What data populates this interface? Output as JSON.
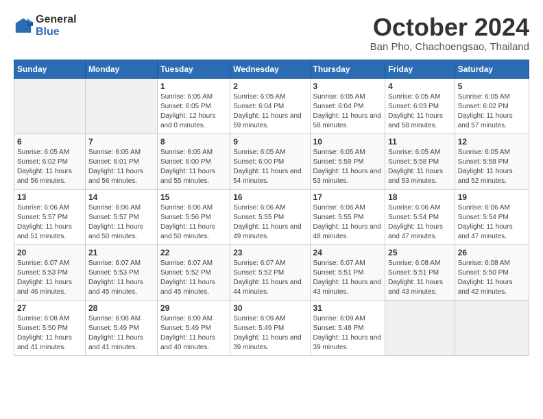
{
  "logo": {
    "general": "General",
    "blue": "Blue"
  },
  "header": {
    "month": "October 2024",
    "location": "Ban Pho, Chachoengsao, Thailand"
  },
  "weekdays": [
    "Sunday",
    "Monday",
    "Tuesday",
    "Wednesday",
    "Thursday",
    "Friday",
    "Saturday"
  ],
  "weeks": [
    [
      {
        "day": "",
        "sunrise": "",
        "sunset": "",
        "daylight": ""
      },
      {
        "day": "",
        "sunrise": "",
        "sunset": "",
        "daylight": ""
      },
      {
        "day": "1",
        "sunrise": "Sunrise: 6:05 AM",
        "sunset": "Sunset: 6:05 PM",
        "daylight": "Daylight: 12 hours and 0 minutes."
      },
      {
        "day": "2",
        "sunrise": "Sunrise: 6:05 AM",
        "sunset": "Sunset: 6:04 PM",
        "daylight": "Daylight: 11 hours and 59 minutes."
      },
      {
        "day": "3",
        "sunrise": "Sunrise: 6:05 AM",
        "sunset": "Sunset: 6:04 PM",
        "daylight": "Daylight: 11 hours and 58 minutes."
      },
      {
        "day": "4",
        "sunrise": "Sunrise: 6:05 AM",
        "sunset": "Sunset: 6:03 PM",
        "daylight": "Daylight: 11 hours and 58 minutes."
      },
      {
        "day": "5",
        "sunrise": "Sunrise: 6:05 AM",
        "sunset": "Sunset: 6:02 PM",
        "daylight": "Daylight: 11 hours and 57 minutes."
      }
    ],
    [
      {
        "day": "6",
        "sunrise": "Sunrise: 6:05 AM",
        "sunset": "Sunset: 6:02 PM",
        "daylight": "Daylight: 11 hours and 56 minutes."
      },
      {
        "day": "7",
        "sunrise": "Sunrise: 6:05 AM",
        "sunset": "Sunset: 6:01 PM",
        "daylight": "Daylight: 11 hours and 56 minutes."
      },
      {
        "day": "8",
        "sunrise": "Sunrise: 6:05 AM",
        "sunset": "Sunset: 6:00 PM",
        "daylight": "Daylight: 11 hours and 55 minutes."
      },
      {
        "day": "9",
        "sunrise": "Sunrise: 6:05 AM",
        "sunset": "Sunset: 6:00 PM",
        "daylight": "Daylight: 11 hours and 54 minutes."
      },
      {
        "day": "10",
        "sunrise": "Sunrise: 6:05 AM",
        "sunset": "Sunset: 5:59 PM",
        "daylight": "Daylight: 11 hours and 53 minutes."
      },
      {
        "day": "11",
        "sunrise": "Sunrise: 6:05 AM",
        "sunset": "Sunset: 5:58 PM",
        "daylight": "Daylight: 11 hours and 53 minutes."
      },
      {
        "day": "12",
        "sunrise": "Sunrise: 6:05 AM",
        "sunset": "Sunset: 5:58 PM",
        "daylight": "Daylight: 11 hours and 52 minutes."
      }
    ],
    [
      {
        "day": "13",
        "sunrise": "Sunrise: 6:06 AM",
        "sunset": "Sunset: 5:57 PM",
        "daylight": "Daylight: 11 hours and 51 minutes."
      },
      {
        "day": "14",
        "sunrise": "Sunrise: 6:06 AM",
        "sunset": "Sunset: 5:57 PM",
        "daylight": "Daylight: 11 hours and 50 minutes."
      },
      {
        "day": "15",
        "sunrise": "Sunrise: 6:06 AM",
        "sunset": "Sunset: 5:56 PM",
        "daylight": "Daylight: 11 hours and 50 minutes."
      },
      {
        "day": "16",
        "sunrise": "Sunrise: 6:06 AM",
        "sunset": "Sunset: 5:55 PM",
        "daylight": "Daylight: 11 hours and 49 minutes."
      },
      {
        "day": "17",
        "sunrise": "Sunrise: 6:06 AM",
        "sunset": "Sunset: 5:55 PM",
        "daylight": "Daylight: 11 hours and 48 minutes."
      },
      {
        "day": "18",
        "sunrise": "Sunrise: 6:06 AM",
        "sunset": "Sunset: 5:54 PM",
        "daylight": "Daylight: 11 hours and 47 minutes."
      },
      {
        "day": "19",
        "sunrise": "Sunrise: 6:06 AM",
        "sunset": "Sunset: 5:54 PM",
        "daylight": "Daylight: 11 hours and 47 minutes."
      }
    ],
    [
      {
        "day": "20",
        "sunrise": "Sunrise: 6:07 AM",
        "sunset": "Sunset: 5:53 PM",
        "daylight": "Daylight: 11 hours and 46 minutes."
      },
      {
        "day": "21",
        "sunrise": "Sunrise: 6:07 AM",
        "sunset": "Sunset: 5:53 PM",
        "daylight": "Daylight: 11 hours and 45 minutes."
      },
      {
        "day": "22",
        "sunrise": "Sunrise: 6:07 AM",
        "sunset": "Sunset: 5:52 PM",
        "daylight": "Daylight: 11 hours and 45 minutes."
      },
      {
        "day": "23",
        "sunrise": "Sunrise: 6:07 AM",
        "sunset": "Sunset: 5:52 PM",
        "daylight": "Daylight: 11 hours and 44 minutes."
      },
      {
        "day": "24",
        "sunrise": "Sunrise: 6:07 AM",
        "sunset": "Sunset: 5:51 PM",
        "daylight": "Daylight: 11 hours and 43 minutes."
      },
      {
        "day": "25",
        "sunrise": "Sunrise: 6:08 AM",
        "sunset": "Sunset: 5:51 PM",
        "daylight": "Daylight: 11 hours and 43 minutes."
      },
      {
        "day": "26",
        "sunrise": "Sunrise: 6:08 AM",
        "sunset": "Sunset: 5:50 PM",
        "daylight": "Daylight: 11 hours and 42 minutes."
      }
    ],
    [
      {
        "day": "27",
        "sunrise": "Sunrise: 6:08 AM",
        "sunset": "Sunset: 5:50 PM",
        "daylight": "Daylight: 11 hours and 41 minutes."
      },
      {
        "day": "28",
        "sunrise": "Sunrise: 6:08 AM",
        "sunset": "Sunset: 5:49 PM",
        "daylight": "Daylight: 11 hours and 41 minutes."
      },
      {
        "day": "29",
        "sunrise": "Sunrise: 6:09 AM",
        "sunset": "Sunset: 5:49 PM",
        "daylight": "Daylight: 11 hours and 40 minutes."
      },
      {
        "day": "30",
        "sunrise": "Sunrise: 6:09 AM",
        "sunset": "Sunset: 5:49 PM",
        "daylight": "Daylight: 11 hours and 39 minutes."
      },
      {
        "day": "31",
        "sunrise": "Sunrise: 6:09 AM",
        "sunset": "Sunset: 5:48 PM",
        "daylight": "Daylight: 11 hours and 39 minutes."
      },
      {
        "day": "",
        "sunrise": "",
        "sunset": "",
        "daylight": ""
      },
      {
        "day": "",
        "sunrise": "",
        "sunset": "",
        "daylight": ""
      }
    ]
  ]
}
